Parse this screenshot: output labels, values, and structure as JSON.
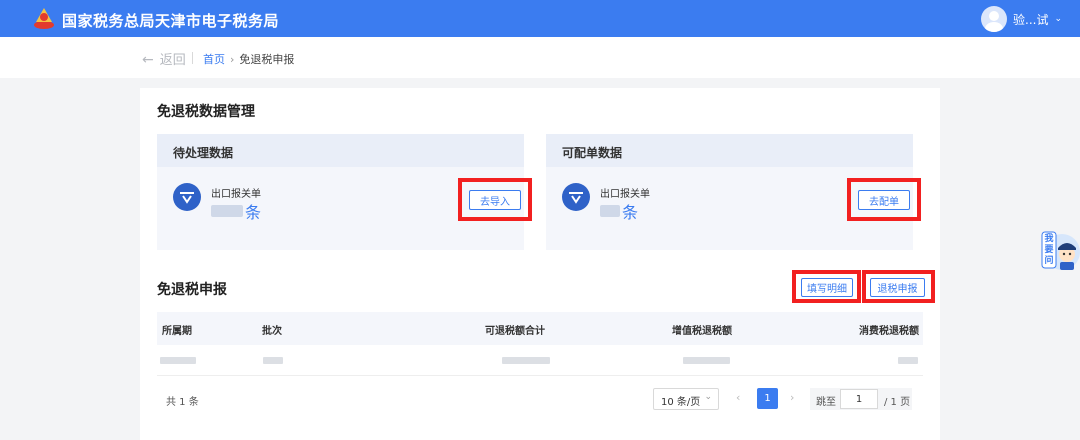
{
  "header": {
    "title": "国家税务总局天津市电子税务局",
    "user_name": "验...试"
  },
  "nav": {
    "back_label": "返回",
    "breadcrumb": [
      "首页",
      "免退税申报"
    ]
  },
  "data_management": {
    "title": "免退税数据管理",
    "pending": {
      "title": "待处理数据",
      "item_label": "出口报关单",
      "count_unit": "条",
      "action_label": "去导入"
    },
    "matchable": {
      "title": "可配单数据",
      "item_label": "出口报关单",
      "count_unit": "条",
      "action_label": "去配单"
    }
  },
  "declaration": {
    "title": "免退税申报",
    "fill_detail_label": "填写明细",
    "declare_label": "退税申报",
    "columns": [
      "所属期",
      "批次",
      "可退税额合计",
      "增值税退税额",
      "消费税退税额"
    ]
  },
  "pagination": {
    "total": "共 1 条",
    "page_size": "10 条/页",
    "current_page": "1",
    "jump_prefix": "跳至",
    "jump_value": "1",
    "jump_suffix": "/ 1 页"
  },
  "assistant": {
    "label": "我要问"
  },
  "colors": {
    "primary": "#3b7cf0",
    "highlight": "#f22020"
  }
}
